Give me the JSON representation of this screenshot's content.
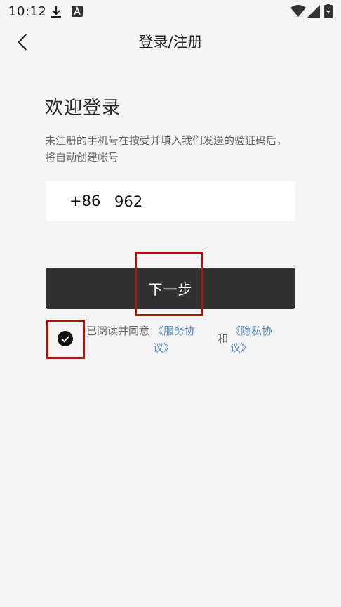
{
  "status_bar": {
    "time": "10:12",
    "icons": [
      "download-icon",
      "notification-app-icon",
      "wifi-icon",
      "signal-icon",
      "battery-icon"
    ]
  },
  "header": {
    "title": "登录/注册",
    "back_icon": "chevron-left-icon"
  },
  "login": {
    "welcome": "欢迎登录",
    "hint": "未注册的手机号在按受并填入我们发送的验证码后，将自动创建帐号",
    "country_code": "+86",
    "phone_value": "962",
    "next_button": "下一步"
  },
  "agreement": {
    "checked": true,
    "prefix": "已阅读并同意",
    "service_link": "《服务协议》",
    "and": "和",
    "privacy_link": "《隐私协议》"
  },
  "colors": {
    "background": "#f5f5f5",
    "button": "#313131",
    "link": "#5b8fc7",
    "highlight": "#a3190f"
  }
}
